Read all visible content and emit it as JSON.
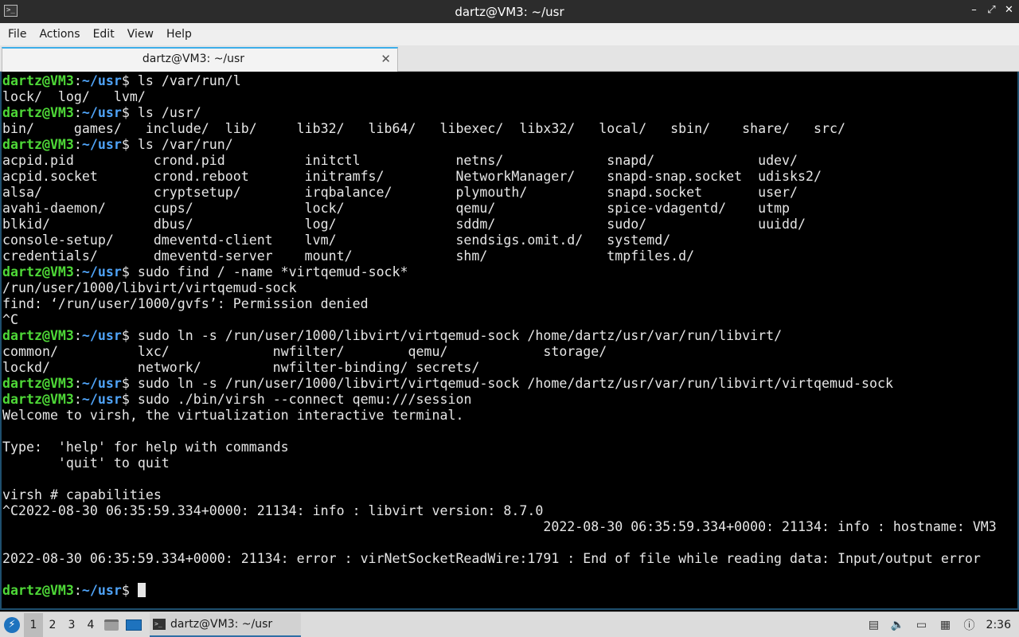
{
  "window": {
    "title": "dartz@VM3: ~/usr",
    "app_icon": ">_",
    "minimize": "–",
    "maximize": "⤢",
    "close": "✕"
  },
  "menu": [
    "File",
    "Actions",
    "Edit",
    "View",
    "Help"
  ],
  "tab": {
    "label": "dartz@VM3: ~/usr",
    "close": "✕"
  },
  "prompt": {
    "user": "dartz@VM3",
    "sep": ":",
    "path": "~/usr",
    "sign": "$ "
  },
  "terminal_lines": [
    {
      "prompt": true,
      "text": "ls /var/run/l"
    },
    {
      "prompt": false,
      "text": "lock/  log/   lvm/"
    },
    {
      "prompt": true,
      "text": "ls /usr/"
    },
    {
      "prompt": false,
      "text": "bin/     games/   include/  lib/     lib32/   lib64/   libexec/  libx32/   local/   sbin/    share/   src/"
    },
    {
      "prompt": true,
      "text": "ls /var/run/"
    },
    {
      "prompt": false,
      "text": "acpid.pid          crond.pid          initctl            netns/             snapd/             udev/"
    },
    {
      "prompt": false,
      "text": "acpid.socket       crond.reboot       initramfs/         NetworkManager/    snapd-snap.socket  udisks2/"
    },
    {
      "prompt": false,
      "text": "alsa/              cryptsetup/        irqbalance/        plymouth/          snapd.socket       user/"
    },
    {
      "prompt": false,
      "text": "avahi-daemon/      cups/              lock/              qemu/              spice-vdagentd/    utmp"
    },
    {
      "prompt": false,
      "text": "blkid/             dbus/              log/               sddm/              sudo/              uuidd/"
    },
    {
      "prompt": false,
      "text": "console-setup/     dmeventd-client    lvm/               sendsigs.omit.d/   systemd/"
    },
    {
      "prompt": false,
      "text": "credentials/       dmeventd-server    mount/             shm/               tmpfiles.d/"
    },
    {
      "prompt": true,
      "text": "sudo find / -name *virtqemud-sock*"
    },
    {
      "prompt": false,
      "text": "/run/user/1000/libvirt/virtqemud-sock"
    },
    {
      "prompt": false,
      "text": "find: ‘/run/user/1000/gvfs’: Permission denied"
    },
    {
      "prompt": false,
      "text": "^C"
    },
    {
      "prompt": true,
      "text": "sudo ln -s /run/user/1000/libvirt/virtqemud-sock /home/dartz/usr/var/run/libvirt/"
    },
    {
      "prompt": false,
      "text": "common/          lxc/             nwfilter/        qemu/            storage/"
    },
    {
      "prompt": false,
      "text": "lockd/           network/         nwfilter-binding/ secrets/"
    },
    {
      "prompt": true,
      "text": "sudo ln -s /run/user/1000/libvirt/virtqemud-sock /home/dartz/usr/var/run/libvirt/virtqemud-sock"
    },
    {
      "prompt": true,
      "text": "sudo ./bin/virsh --connect qemu:///session"
    },
    {
      "prompt": false,
      "text": "Welcome to virsh, the virtualization interactive terminal."
    },
    {
      "prompt": false,
      "text": ""
    },
    {
      "prompt": false,
      "text": "Type:  'help' for help with commands"
    },
    {
      "prompt": false,
      "text": "       'quit' to quit"
    },
    {
      "prompt": false,
      "text": ""
    },
    {
      "prompt": false,
      "text": "virsh # capabilities"
    },
    {
      "prompt": false,
      "text": "^C2022-08-30 06:35:59.334+0000: 21134: info : libvirt version: 8.7.0"
    },
    {
      "prompt": false,
      "text": "                                                                    2022-08-30 06:35:59.334+0000: 21134: info : hostname: VM3"
    },
    {
      "prompt": false,
      "text": ""
    },
    {
      "prompt": false,
      "text": "2022-08-30 06:35:59.334+0000: 21134: error : virNetSocketReadWire:1791 : End of file while reading data: Input/output error"
    },
    {
      "prompt": false,
      "text": ""
    },
    {
      "prompt": true,
      "text": "",
      "cursor": true
    }
  ],
  "taskbar": {
    "workspaces": [
      "1",
      "2",
      "3",
      "4"
    ],
    "active_workspace": "1",
    "task_label": "dartz@VM3: ~/usr",
    "task_icon": ">_",
    "clock": "2:36",
    "icons": [
      "start-menu-icon",
      "file-manager-icon",
      "show-desktop-icon",
      "terminal-icon",
      "clipboard-icon",
      "volume-icon",
      "removable-drive-icon",
      "network-icon",
      "notification-icon"
    ]
  }
}
